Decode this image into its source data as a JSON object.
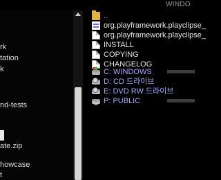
{
  "window": {
    "title": "WINDO"
  },
  "left_pane": {
    "items": [
      {
        "label": "rk"
      },
      {
        "label": "tation"
      },
      {
        "label": "k"
      },
      {
        "label": "nd-tests"
      },
      {
        "label": "ate.zip"
      },
      {
        "label": "howcase"
      },
      {
        "label": "t"
      }
    ]
  },
  "file_pane": {
    "parent": {
      "label": "..",
      "icon": "folder-icon"
    },
    "files": [
      {
        "label": "org.playframework.playclipse_",
        "icon": "doc-icon"
      },
      {
        "label": "org.playframework.playclipse_",
        "icon": "file-icon"
      },
      {
        "label": "INSTALL",
        "icon": "file-icon"
      },
      {
        "label": "COPYING",
        "icon": "file-icon"
      },
      {
        "label": "CHANGELOG",
        "icon": "file-icon"
      }
    ],
    "drives": [
      {
        "label": "C: WINDOWS",
        "icon": "windows-drive-icon"
      },
      {
        "label": "D: CD 드라이브",
        "icon": "cd-drive-icon"
      },
      {
        "label": "E: DVD RW 드라이브",
        "icon": "dvd-drive-icon"
      },
      {
        "label": "P: PUBLIC",
        "icon": "network-drive-icon"
      }
    ]
  },
  "colors": {
    "drive_text": "#a9a9ff",
    "parent_text": "#ff4040",
    "folder": "#e2b43c"
  }
}
